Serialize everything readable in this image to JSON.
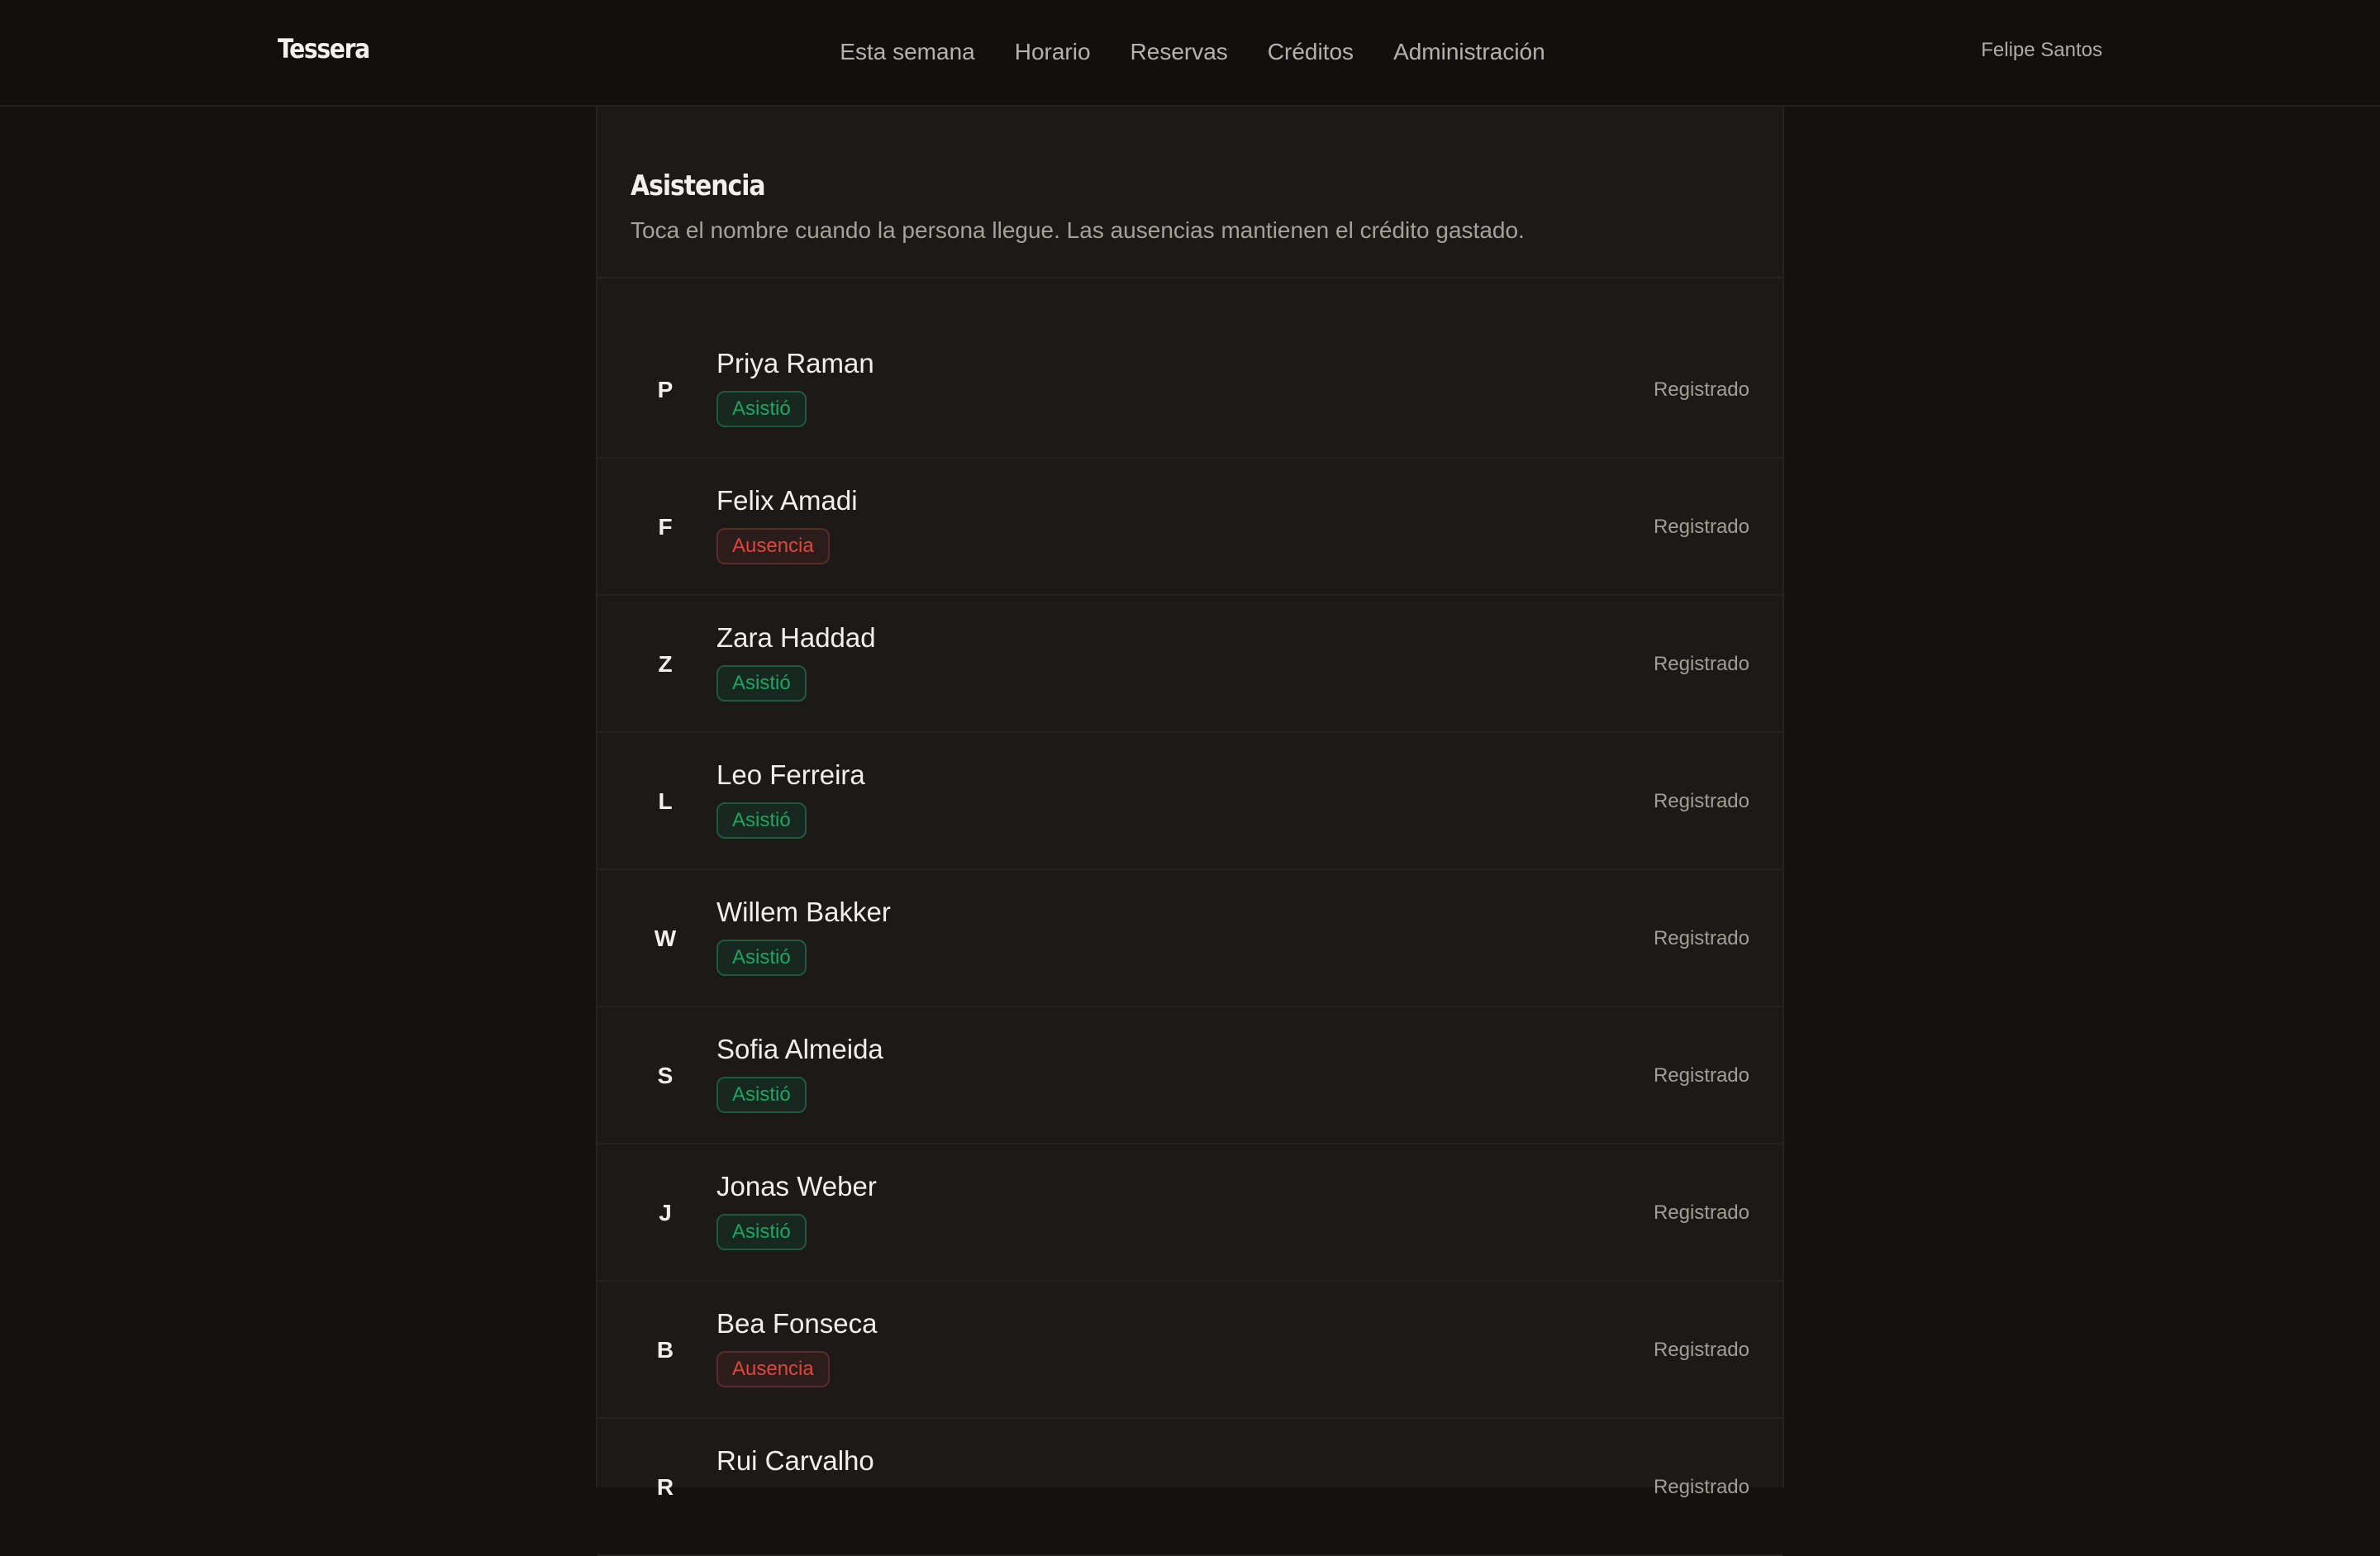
{
  "header": {
    "brand": "Tessera",
    "nav": [
      {
        "label": "Esta semana"
      },
      {
        "label": "Horario"
      },
      {
        "label": "Reservas"
      },
      {
        "label": "Créditos"
      },
      {
        "label": "Administración"
      }
    ],
    "user": "Felipe Santos"
  },
  "attendance": {
    "title": "Asistencia",
    "subtitle": "Toca el nombre cuando la persona llegue. Las ausencias mantienen el crédito gastado.",
    "rows": [
      {
        "initial": "P",
        "name": "Priya Raman",
        "badge": "Asistió",
        "status": "ok",
        "state": "Registrado"
      },
      {
        "initial": "F",
        "name": "Felix Amadi",
        "badge": "Ausencia",
        "status": "no",
        "state": "Registrado"
      },
      {
        "initial": "Z",
        "name": "Zara Haddad",
        "badge": "Asistió",
        "status": "ok",
        "state": "Registrado"
      },
      {
        "initial": "L",
        "name": "Leo Ferreira",
        "badge": "Asistió",
        "status": "ok",
        "state": "Registrado"
      },
      {
        "initial": "W",
        "name": "Willem Bakker",
        "badge": "Asistió",
        "status": "ok",
        "state": "Registrado"
      },
      {
        "initial": "S",
        "name": "Sofia Almeida",
        "badge": "Asistió",
        "status": "ok",
        "state": "Registrado"
      },
      {
        "initial": "J",
        "name": "Jonas Weber",
        "badge": "Asistió",
        "status": "ok",
        "state": "Registrado"
      },
      {
        "initial": "B",
        "name": "Bea Fonseca",
        "badge": "Ausencia",
        "status": "no",
        "state": "Registrado"
      },
      {
        "initial": "R",
        "name": "Rui Carvalho",
        "badge": "",
        "status": "ok",
        "state": "Registrado"
      }
    ]
  },
  "colors": {
    "background": "#14110f",
    "panel": "#1c1917",
    "attended": "#1fa463",
    "absent": "#e0463e"
  }
}
